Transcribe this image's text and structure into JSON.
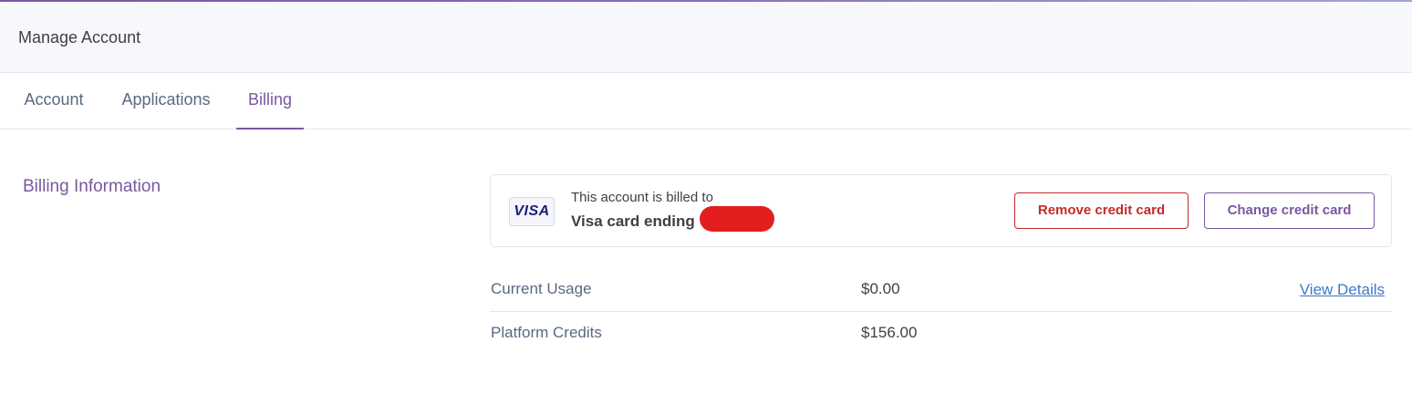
{
  "header": {
    "title": "Manage Account"
  },
  "tabs": [
    {
      "label": "Account"
    },
    {
      "label": "Applications"
    },
    {
      "label": "Billing"
    }
  ],
  "active_tab": "Billing",
  "billing": {
    "section_title": "Billing Information",
    "card": {
      "brand_logo": "VISA",
      "billed_to_text": "This account is billed to",
      "card_text": "Visa card ending"
    },
    "buttons": {
      "remove": "Remove credit card",
      "change": "Change credit card"
    },
    "rows": [
      {
        "label": "Current Usage",
        "value": "$0.00",
        "link": "View Details"
      },
      {
        "label": "Platform Credits",
        "value": "$156.00"
      }
    ]
  },
  "colors": {
    "accent": "#79589f",
    "danger": "#c52b2b",
    "link": "#3b7ac9",
    "redaction": "#e31e1e"
  }
}
